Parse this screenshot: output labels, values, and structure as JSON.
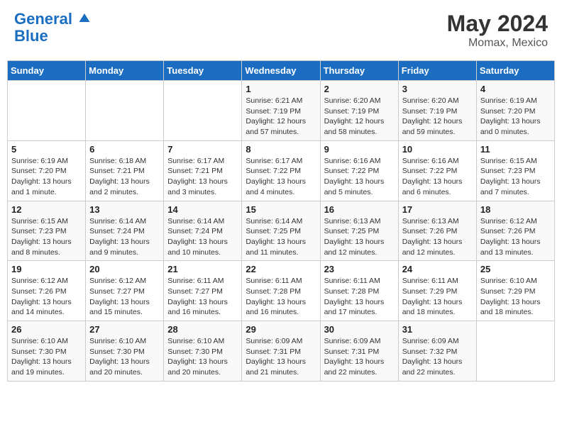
{
  "header": {
    "logo_line1": "General",
    "logo_line2": "Blue",
    "month_title": "May 2024",
    "location": "Momax, Mexico"
  },
  "days_of_week": [
    "Sunday",
    "Monday",
    "Tuesday",
    "Wednesday",
    "Thursday",
    "Friday",
    "Saturday"
  ],
  "weeks": [
    [
      {
        "day": "",
        "info": ""
      },
      {
        "day": "",
        "info": ""
      },
      {
        "day": "",
        "info": ""
      },
      {
        "day": "1",
        "info": "Sunrise: 6:21 AM\nSunset: 7:19 PM\nDaylight: 12 hours and 57 minutes."
      },
      {
        "day": "2",
        "info": "Sunrise: 6:20 AM\nSunset: 7:19 PM\nDaylight: 12 hours and 58 minutes."
      },
      {
        "day": "3",
        "info": "Sunrise: 6:20 AM\nSunset: 7:19 PM\nDaylight: 12 hours and 59 minutes."
      },
      {
        "day": "4",
        "info": "Sunrise: 6:19 AM\nSunset: 7:20 PM\nDaylight: 13 hours and 0 minutes."
      }
    ],
    [
      {
        "day": "5",
        "info": "Sunrise: 6:19 AM\nSunset: 7:20 PM\nDaylight: 13 hours and 1 minute."
      },
      {
        "day": "6",
        "info": "Sunrise: 6:18 AM\nSunset: 7:21 PM\nDaylight: 13 hours and 2 minutes."
      },
      {
        "day": "7",
        "info": "Sunrise: 6:17 AM\nSunset: 7:21 PM\nDaylight: 13 hours and 3 minutes."
      },
      {
        "day": "8",
        "info": "Sunrise: 6:17 AM\nSunset: 7:22 PM\nDaylight: 13 hours and 4 minutes."
      },
      {
        "day": "9",
        "info": "Sunrise: 6:16 AM\nSunset: 7:22 PM\nDaylight: 13 hours and 5 minutes."
      },
      {
        "day": "10",
        "info": "Sunrise: 6:16 AM\nSunset: 7:22 PM\nDaylight: 13 hours and 6 minutes."
      },
      {
        "day": "11",
        "info": "Sunrise: 6:15 AM\nSunset: 7:23 PM\nDaylight: 13 hours and 7 minutes."
      }
    ],
    [
      {
        "day": "12",
        "info": "Sunrise: 6:15 AM\nSunset: 7:23 PM\nDaylight: 13 hours and 8 minutes."
      },
      {
        "day": "13",
        "info": "Sunrise: 6:14 AM\nSunset: 7:24 PM\nDaylight: 13 hours and 9 minutes."
      },
      {
        "day": "14",
        "info": "Sunrise: 6:14 AM\nSunset: 7:24 PM\nDaylight: 13 hours and 10 minutes."
      },
      {
        "day": "15",
        "info": "Sunrise: 6:14 AM\nSunset: 7:25 PM\nDaylight: 13 hours and 11 minutes."
      },
      {
        "day": "16",
        "info": "Sunrise: 6:13 AM\nSunset: 7:25 PM\nDaylight: 13 hours and 12 minutes."
      },
      {
        "day": "17",
        "info": "Sunrise: 6:13 AM\nSunset: 7:26 PM\nDaylight: 13 hours and 12 minutes."
      },
      {
        "day": "18",
        "info": "Sunrise: 6:12 AM\nSunset: 7:26 PM\nDaylight: 13 hours and 13 minutes."
      }
    ],
    [
      {
        "day": "19",
        "info": "Sunrise: 6:12 AM\nSunset: 7:26 PM\nDaylight: 13 hours and 14 minutes."
      },
      {
        "day": "20",
        "info": "Sunrise: 6:12 AM\nSunset: 7:27 PM\nDaylight: 13 hours and 15 minutes."
      },
      {
        "day": "21",
        "info": "Sunrise: 6:11 AM\nSunset: 7:27 PM\nDaylight: 13 hours and 16 minutes."
      },
      {
        "day": "22",
        "info": "Sunrise: 6:11 AM\nSunset: 7:28 PM\nDaylight: 13 hours and 16 minutes."
      },
      {
        "day": "23",
        "info": "Sunrise: 6:11 AM\nSunset: 7:28 PM\nDaylight: 13 hours and 17 minutes."
      },
      {
        "day": "24",
        "info": "Sunrise: 6:11 AM\nSunset: 7:29 PM\nDaylight: 13 hours and 18 minutes."
      },
      {
        "day": "25",
        "info": "Sunrise: 6:10 AM\nSunset: 7:29 PM\nDaylight: 13 hours and 18 minutes."
      }
    ],
    [
      {
        "day": "26",
        "info": "Sunrise: 6:10 AM\nSunset: 7:30 PM\nDaylight: 13 hours and 19 minutes."
      },
      {
        "day": "27",
        "info": "Sunrise: 6:10 AM\nSunset: 7:30 PM\nDaylight: 13 hours and 20 minutes."
      },
      {
        "day": "28",
        "info": "Sunrise: 6:10 AM\nSunset: 7:30 PM\nDaylight: 13 hours and 20 minutes."
      },
      {
        "day": "29",
        "info": "Sunrise: 6:09 AM\nSunset: 7:31 PM\nDaylight: 13 hours and 21 minutes."
      },
      {
        "day": "30",
        "info": "Sunrise: 6:09 AM\nSunset: 7:31 PM\nDaylight: 13 hours and 22 minutes."
      },
      {
        "day": "31",
        "info": "Sunrise: 6:09 AM\nSunset: 7:32 PM\nDaylight: 13 hours and 22 minutes."
      },
      {
        "day": "",
        "info": ""
      }
    ]
  ]
}
